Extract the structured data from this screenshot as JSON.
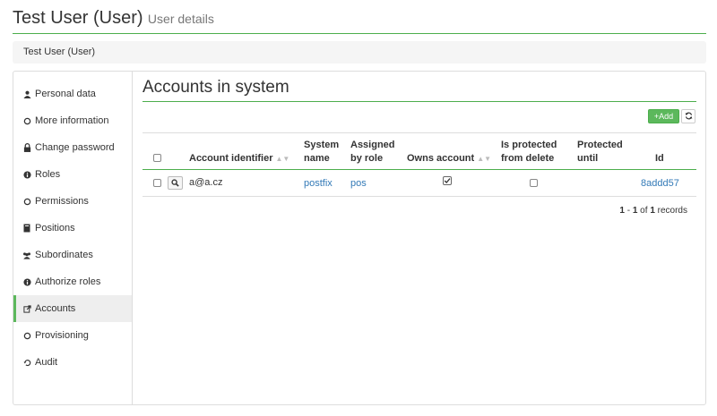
{
  "header": {
    "title": "Test User (User)",
    "subtitle": "User details"
  },
  "breadcrumb": {
    "text": "Test User (User)"
  },
  "sidebar": {
    "items": [
      {
        "label": "Personal data",
        "icon": "user-icon"
      },
      {
        "label": "More information",
        "icon": "circle-icon"
      },
      {
        "label": "Change password",
        "icon": "lock-icon"
      },
      {
        "label": "Roles",
        "icon": "info-icon"
      },
      {
        "label": "Permissions",
        "icon": "circle-icon"
      },
      {
        "label": "Positions",
        "icon": "book-icon"
      },
      {
        "label": "Subordinates",
        "icon": "users-icon"
      },
      {
        "label": "Authorize roles",
        "icon": "info-icon"
      },
      {
        "label": "Accounts",
        "icon": "external-link-icon",
        "active": true
      },
      {
        "label": "Provisioning",
        "icon": "circle-icon"
      },
      {
        "label": "Audit",
        "icon": "history-icon"
      }
    ]
  },
  "main": {
    "title": "Accounts in system",
    "add_label": "Add",
    "table": {
      "columns": {
        "account_identifier": "Account identifier",
        "system_name_1": "System",
        "system_name_2": "name",
        "assigned_1": "Assigned",
        "assigned_2": "by role",
        "owns_account": "Owns account",
        "protected_1": "Is protected",
        "protected_2": "from delete",
        "until_1": "Protected",
        "until_2": "until",
        "id": "Id"
      },
      "rows": [
        {
          "account_identifier": "a@a.cz",
          "system_name": "postfix",
          "assigned_by_role": "pos",
          "owns_account": true,
          "protected": false,
          "protected_until": "",
          "id": "8addd57"
        }
      ]
    },
    "pagination": {
      "from": "1",
      "sep": " - ",
      "to": "1",
      "of": " of ",
      "total": "1",
      "records": " records"
    }
  },
  "colors": {
    "accent": "#5cb85c",
    "link": "#337ab7"
  }
}
